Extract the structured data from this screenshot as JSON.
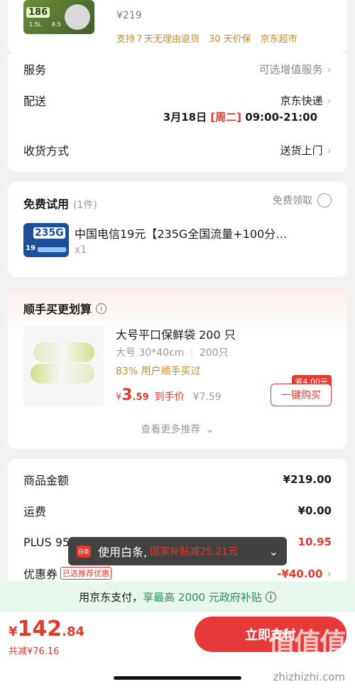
{
  "top_product": {
    "price": "¥219",
    "thumb_tag": "186",
    "thumb_sub": "1.5L",
    "thumb_sub2": "8.5",
    "service_tags": "支持７天无理由退货　30 天价保　京东超市"
  },
  "service": {
    "label": "服务",
    "value": "可选增值服务"
  },
  "delivery": {
    "label": "配送",
    "carrier": "京东快递",
    "date": "3月18日",
    "weekday": "[周二]",
    "time": "09:00-21:00"
  },
  "receive": {
    "label": "收货方式",
    "value": "送货上门"
  },
  "free_trial": {
    "title": "免费试用",
    "count": "(1件)",
    "claim_label": "免费领取",
    "item_name": "中国电信19元【235G全国流量+100分…",
    "qty": "x1",
    "thumb_big": "235G",
    "thumb_small": "19"
  },
  "addon": {
    "title": "顺手买更划算",
    "product_name": "大号平口保鲜袋 200 只",
    "spec1": "大号 30*40cm",
    "spec2": "200只",
    "promo": "83% 用户顺手买过",
    "price_int": "3",
    "price_dec": ".59",
    "price_label": "到手价",
    "orig_price": "¥7.59",
    "save_badge": "省4.00元",
    "buy_button": "一键购买",
    "more": "查看更多推荐"
  },
  "summary": {
    "rows": [
      {
        "label": "商品金额",
        "value": "¥219.00"
      },
      {
        "label": "运费",
        "value": "¥0.00"
      },
      {
        "label": "PLUS 95",
        "value": "10.95"
      },
      {
        "label": "优惠券",
        "tag": "已选推荐优惠",
        "value": "-¥40.00"
      }
    ]
  },
  "toast": {
    "icon_text": "白条",
    "text": "使用白条,",
    "highlight": "国家补贴减25.21元"
  },
  "gov_banner": {
    "text": "用京东支付，",
    "highlight": "享最高 2000 元政府补贴"
  },
  "footer": {
    "currency": "¥",
    "total_int": "142",
    "total_dec": ".84",
    "saved": "共减¥76.16",
    "pay_button": "立即支付"
  },
  "watermark": {
    "text": "zhizhizhi.com",
    "logo": "值值值"
  }
}
